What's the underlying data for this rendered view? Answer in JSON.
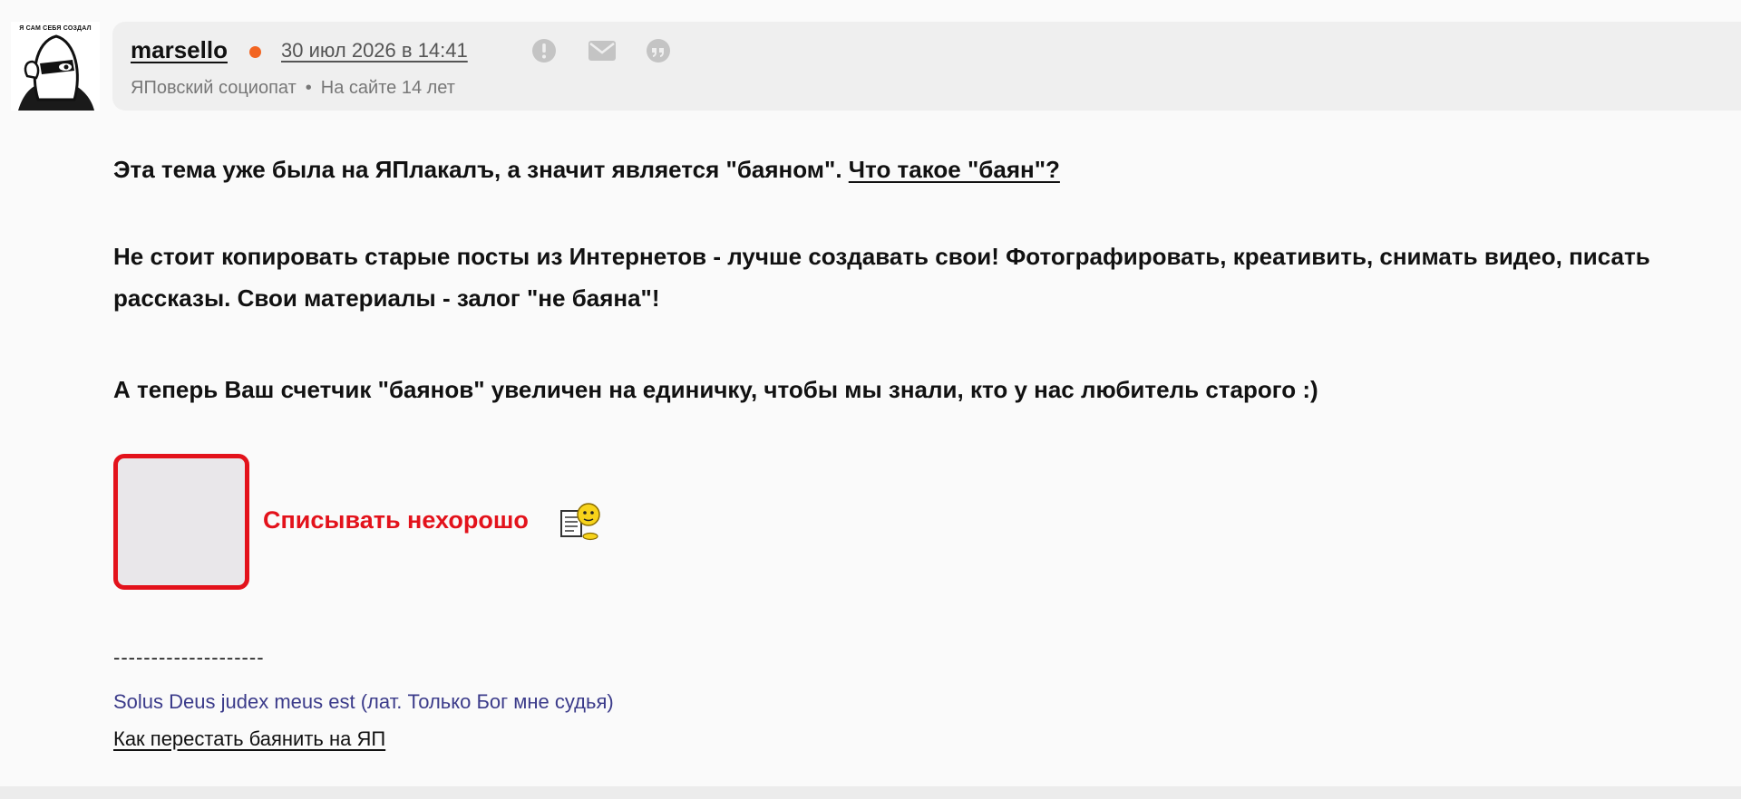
{
  "author": {
    "avatar_caption": "Я САМ СЕБЯ СОЗДАЛ",
    "username": "marsello",
    "status_color": "#f26522",
    "post_date": "30 июл 2026 в 14:41",
    "rank": "ЯПовский социопат",
    "separator": "•",
    "site_age": "На сайте 14 лет",
    "icons": [
      "warning-icon",
      "mail-icon",
      "quote-icon"
    ]
  },
  "post": {
    "p1_text": "Эта тема уже была на ЯПлакалъ, а значит является \"баяном\". ",
    "p1_link": "Что такое \"баян\"?",
    "p2_text": "Не стоит копировать старые посты из Интернетов - лучше создавать свои! Фотографировать, креативить, снимать видео, писать рассказы. Свои материалы - залог \"не баяна\"!",
    "p3_text": "А теперь Ваш счетчик \"баянов\" увеличен на единичку, чтобы мы знали, кто у нас любитель старого :)",
    "notice_text": "Списывать нехорошо",
    "accent_color": "#e3121b"
  },
  "signature": {
    "divider": "--------------------",
    "quote": "Solus Deus judex meus est (лат. Только Бог мне судья)",
    "link": "Как перестать баянить на ЯП"
  }
}
